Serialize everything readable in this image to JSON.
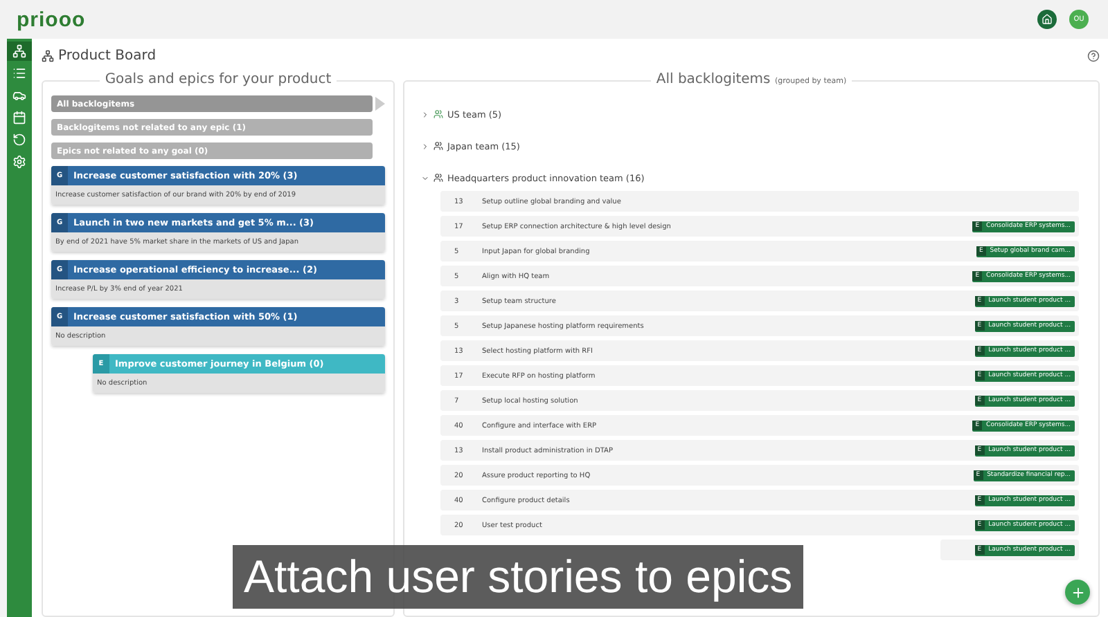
{
  "header": {
    "logo": "priooo",
    "avatar": "OU"
  },
  "sidebar": {
    "items": [
      {
        "kind": "sitemap",
        "selected": true
      },
      {
        "kind": "list",
        "selected": false
      },
      {
        "kind": "road",
        "selected": false
      },
      {
        "kind": "calendar",
        "selected": false
      },
      {
        "kind": "history",
        "selected": false
      },
      {
        "kind": "settings",
        "selected": false
      }
    ]
  },
  "page": {
    "title": "Product Board"
  },
  "goals_panel": {
    "title": "Goals and epics for your product",
    "filters": [
      {
        "label": "All backlogitems",
        "selected": true
      },
      {
        "label": "Backlogitems not related to any epic (1)",
        "selected": false
      },
      {
        "label": "Epics not related to any goal (0)",
        "selected": false
      }
    ],
    "goals": [
      {
        "kind": "goal",
        "badge": "G",
        "title": "Increase customer satisfaction with 20% (3)",
        "description": "Increase customer satisfaction of our brand with 20% by end of 2019"
      },
      {
        "kind": "goal",
        "badge": "G",
        "title": "Launch in two new markets and get 5% m...  (3)",
        "description": "By end of 2021 have 5% market share in the markets of US and Japan"
      },
      {
        "kind": "goal",
        "badge": "G",
        "title": "Increase operational efficiency to increase...  (2)",
        "description": "Increase P/L by 3% end of year 2021"
      },
      {
        "kind": "goal",
        "badge": "G",
        "title": "Increase customer satisfaction with 50% (1)",
        "description": "No description",
        "children": [
          {
            "kind": "epic",
            "badge": "E",
            "title": "Improve customer journey in Belgium (0)",
            "description": "No description"
          }
        ]
      }
    ]
  },
  "backlog_panel": {
    "title": "All backlogitems",
    "subtitle": "(grouped by team)",
    "teams": [
      {
        "name": "US team (5)",
        "expanded": false
      },
      {
        "name": "Japan team (15)",
        "expanded": false
      },
      {
        "name": "Headquarters product innovation team (16)",
        "expanded": true,
        "items": [
          {
            "points": "13",
            "title": "Setup outline global branding and value"
          },
          {
            "points": "17",
            "title": "Setup ERP connection architecture & high level design",
            "epic_badge": "E",
            "epic": "Consolidate ERP systems..."
          },
          {
            "points": "5",
            "title": "Input Japan for global branding",
            "epic_badge": "E",
            "epic": "Setup global brand cam..."
          },
          {
            "points": "5",
            "title": "Align with HQ team",
            "epic_badge": "E",
            "epic": "Consolidate ERP systems..."
          },
          {
            "points": "3",
            "title": "Setup team structure",
            "epic_badge": "E",
            "epic": "Launch student product ..."
          },
          {
            "points": "5",
            "title": "Setup Japanese hosting platform requirements",
            "epic_badge": "E",
            "epic": "Launch student product ..."
          },
          {
            "points": "13",
            "title": "Select hosting platform with RFI",
            "epic_badge": "E",
            "epic": "Launch student product ..."
          },
          {
            "points": "17",
            "title": "Execute RFP on hosting platform",
            "epic_badge": "E",
            "epic": "Launch student product ..."
          },
          {
            "points": "7",
            "title": "Setup local hosting solution",
            "epic_badge": "E",
            "epic": "Launch student product ..."
          },
          {
            "points": "40",
            "title": "Configure and interface with ERP",
            "epic_badge": "E",
            "epic": "Consolidate ERP systems..."
          },
          {
            "points": "13",
            "title": "Install product administration in DTAP",
            "epic_badge": "E",
            "epic": "Launch student product ..."
          },
          {
            "points": "20",
            "title": "Assure product reporting to HQ",
            "epic_badge": "E",
            "epic": "Standardize financial rep..."
          },
          {
            "points": "40",
            "title": "Configure product details",
            "epic_badge": "E",
            "epic": "Launch student product ..."
          },
          {
            "points": "20",
            "title": "User test product",
            "epic_badge": "E",
            "epic": "Launch student product ..."
          },
          {
            "epic_badge": "E",
            "epic": "Launch student product ..."
          }
        ]
      }
    ]
  },
  "caption": "Attach user stories to epics"
}
